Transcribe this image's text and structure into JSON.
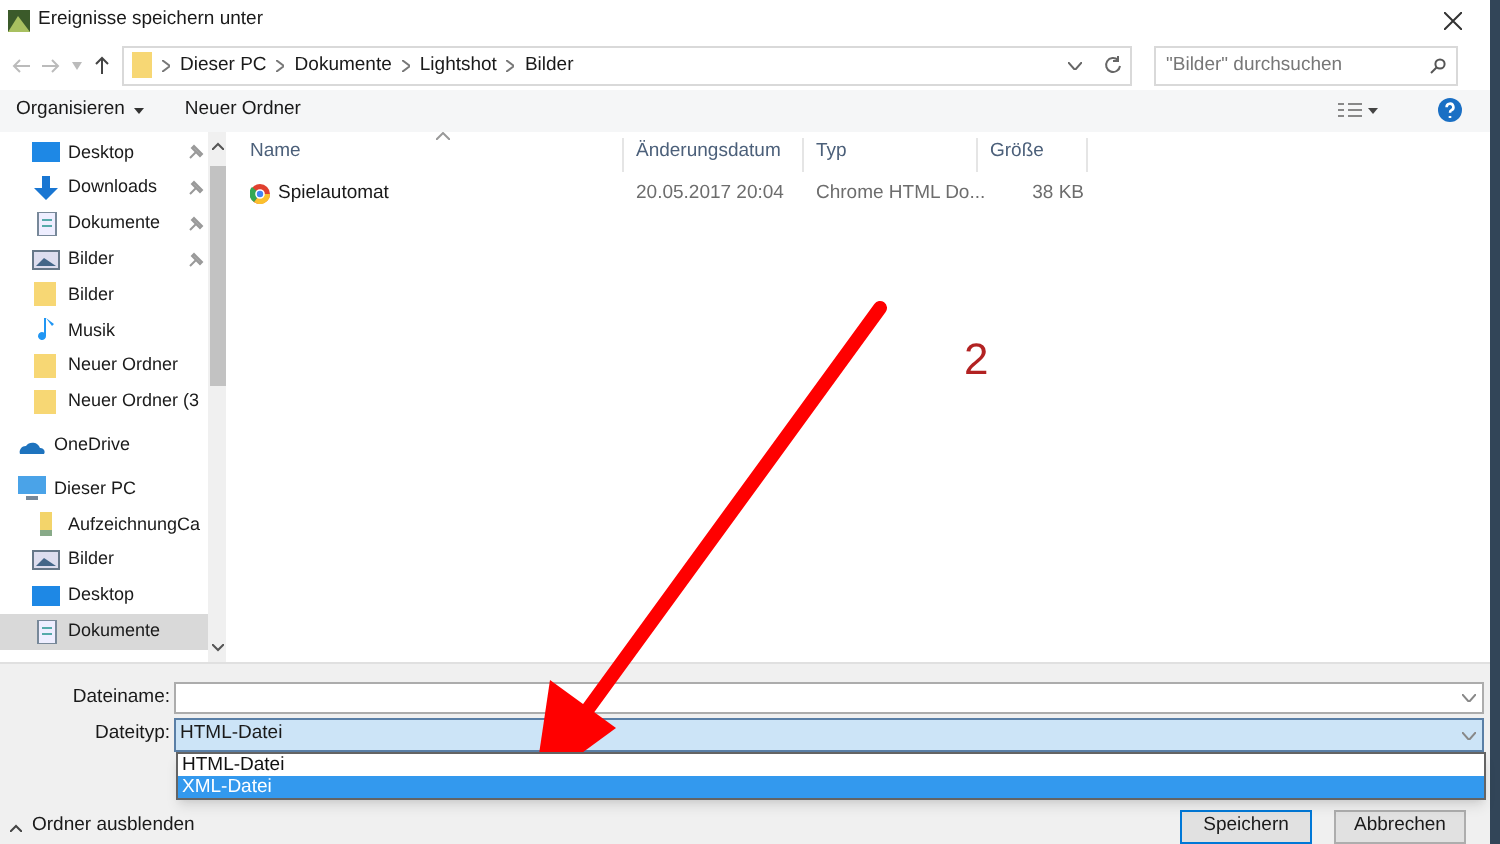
{
  "window": {
    "title": "Ereignisse speichern unter"
  },
  "breadcrumb": [
    "Dieser PC",
    "Dokumente",
    "Lightshot",
    "Bilder"
  ],
  "search": {
    "placeholder": "\"Bilder\" durchsuchen"
  },
  "toolbar": {
    "organize": "Organisieren",
    "new_folder": "Neuer Ordner"
  },
  "sidebar": {
    "quick_access": [
      {
        "label": "Desktop",
        "kind": "desktop",
        "pinned": true,
        "selected": false
      },
      {
        "label": "Downloads",
        "kind": "download",
        "pinned": true,
        "selected": false
      },
      {
        "label": "Dokumente",
        "kind": "document",
        "pinned": true,
        "selected": false
      },
      {
        "label": "Bilder",
        "kind": "pictures",
        "pinned": true,
        "selected": false
      },
      {
        "label": "Bilder",
        "kind": "folder",
        "pinned": false,
        "selected": false
      },
      {
        "label": "Musik",
        "kind": "music",
        "pinned": false,
        "selected": false
      },
      {
        "label": "Neuer Ordner",
        "kind": "folder",
        "pinned": false,
        "selected": false
      },
      {
        "label": "Neuer Ordner (3",
        "kind": "folder",
        "pinned": false,
        "selected": false
      }
    ],
    "roots": [
      {
        "label": "OneDrive",
        "kind": "cloud",
        "selected": false
      },
      {
        "label": "Dieser PC",
        "kind": "pc",
        "selected": false,
        "children": [
          {
            "label": "AufzeichnungCa",
            "kind": "library",
            "pinned": false,
            "selected": false
          },
          {
            "label": "Bilder",
            "kind": "pictures",
            "pinned": false,
            "selected": false
          },
          {
            "label": "Desktop",
            "kind": "desktop",
            "pinned": false,
            "selected": false
          },
          {
            "label": "Dokumente",
            "kind": "document",
            "pinned": false,
            "selected": true
          }
        ]
      }
    ]
  },
  "table": {
    "columns": [
      "Name",
      "Änderungsdatum",
      "Typ",
      "Größe"
    ],
    "rows": [
      {
        "name": "Spielautomat",
        "date": "20.05.2017 20:04",
        "type": "Chrome HTML Do...",
        "size": "38 KB"
      }
    ]
  },
  "annotation": {
    "label": "2"
  },
  "form": {
    "filename_label": "Dateiname:",
    "filetype_label": "Dateityp:",
    "filetype_value": "HTML-Datei",
    "options": [
      {
        "label": "HTML-Datei",
        "selected": false
      },
      {
        "label": "XML-Datei",
        "selected": true
      }
    ]
  },
  "hide_folders": "Ordner ausblenden",
  "buttons": [
    "Speichern",
    "Abbrechen"
  ]
}
